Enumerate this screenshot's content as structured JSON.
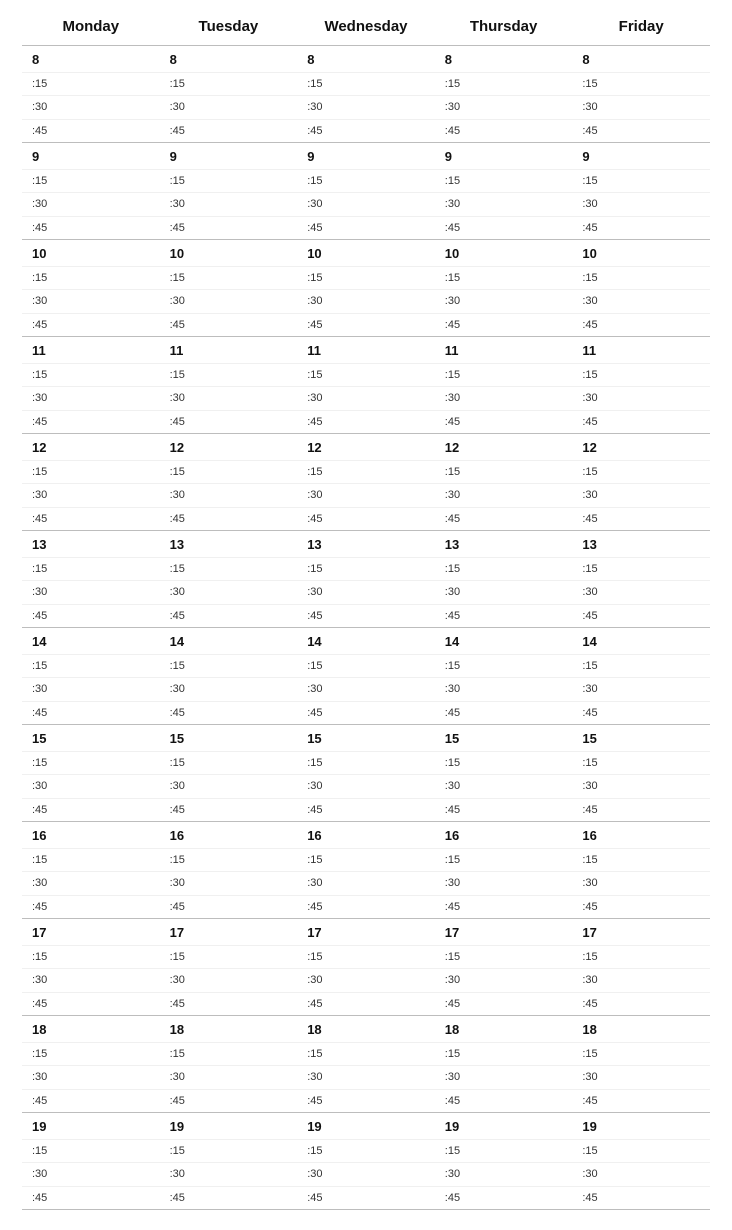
{
  "days": [
    "Monday",
    "Tuesday",
    "Wednesday",
    "Thursday",
    "Friday"
  ],
  "hours": [
    "8",
    "9",
    "10",
    "11",
    "12",
    "13",
    "14",
    "15",
    "16",
    "17",
    "18",
    "19"
  ],
  "minutes": [
    ":15",
    ":30",
    ":45"
  ]
}
